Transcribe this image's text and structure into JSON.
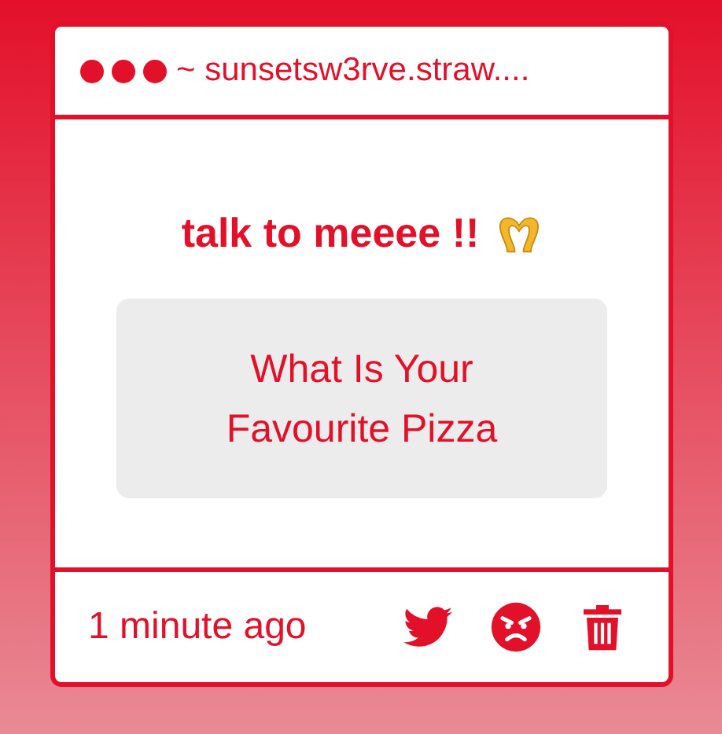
{
  "window": {
    "title": "~ sunsetsw3rve.straw...."
  },
  "message": {
    "heading": "talk to meeee !!",
    "question": "What Is Your Favourite Pizza"
  },
  "footer": {
    "time": "1 minute ago"
  }
}
